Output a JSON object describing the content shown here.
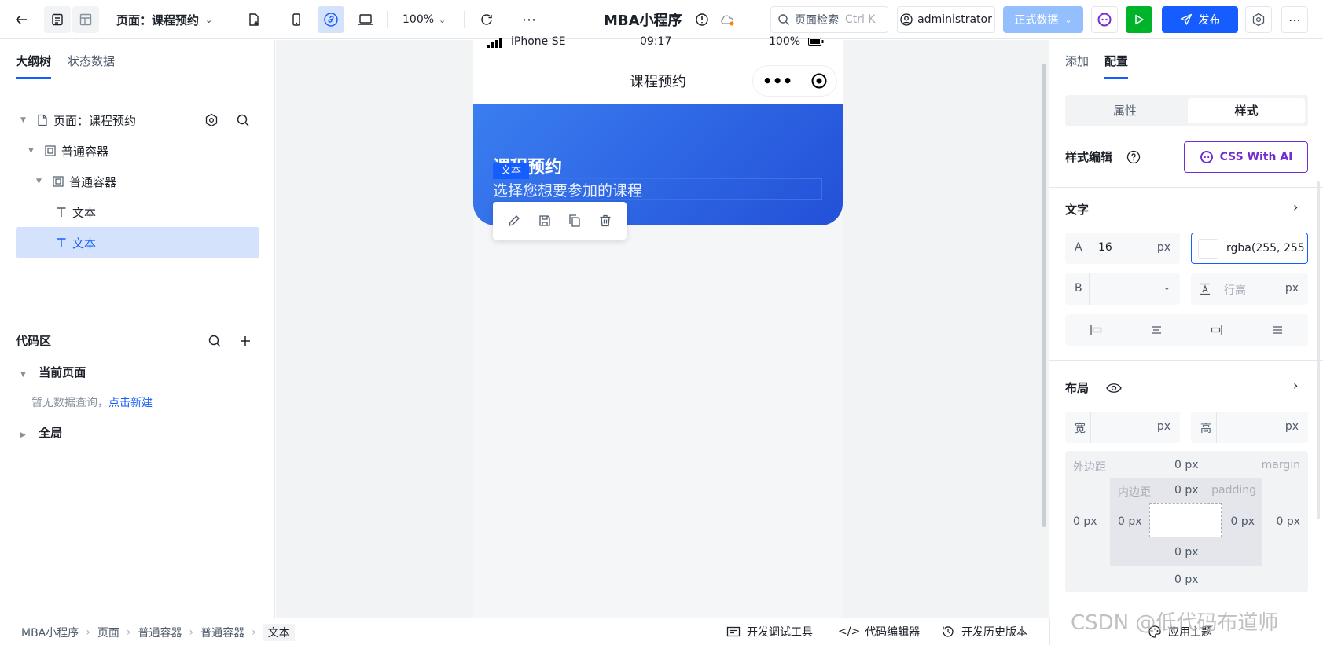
{
  "topbar": {
    "page_selector": "页面：课程预约",
    "zoom": "100%",
    "app_title": "MBA小程序",
    "search_placeholder": "页面检索",
    "search_shortcut": "Ctrl K",
    "user": "administrator",
    "env_label": "正式数据",
    "publish_label": "发布"
  },
  "left": {
    "tabs": [
      "大纲树",
      "状态数据"
    ],
    "tree": [
      {
        "label": "页面：课程预约"
      },
      {
        "label": "普通容器"
      },
      {
        "label": "普通容器"
      },
      {
        "label": "文本"
      },
      {
        "label": "文本"
      }
    ],
    "code": {
      "title": "代码区",
      "current_page": "当前页面",
      "empty_text": "暂无数据查询，",
      "create_link": "点击新建",
      "global": "全局"
    }
  },
  "phone": {
    "carrier": "iPhone SE",
    "time": "09:17",
    "battery": "100%",
    "nav_title": "课程预约",
    "hero_title": "课程预约",
    "hero_subtitle": "选择您想要参加的课程",
    "selection_tag": "文本",
    "hero_color_from": "#3a7ef0",
    "hero_color_to": "#2350d8"
  },
  "right": {
    "tabs": [
      "添加",
      "配置"
    ],
    "seg": [
      "属性",
      "样式"
    ],
    "style_edit": "样式编辑",
    "css_ai": "CSS With AI",
    "text_section": "文字",
    "font_size_label": "A",
    "font_size": "16",
    "unit_px": "px",
    "color_value": "rgba(255, 255",
    "weight_label": "B",
    "line_height_placeholder": "行高",
    "layout_section": "布局",
    "width_label": "宽",
    "height_label": "高",
    "margin_label": "外边距",
    "margin_en": "margin",
    "padding_label": "内边距",
    "padding_en": "padding",
    "zero": "0",
    "zero_px": "0 px"
  },
  "bottom": {
    "breadcrumb": [
      "MBA小程序",
      "页面",
      "普通容器",
      "普通容器",
      "文本"
    ],
    "dev_tools": "开发调试工具",
    "code_editor": "代码编辑器",
    "history": "开发历史版本",
    "theme": "应用主题",
    "watermark": "CSDN @低代码布道师"
  },
  "colors": {
    "accent": "#165dff",
    "run": "#00b42a",
    "env": "#94bfff"
  }
}
